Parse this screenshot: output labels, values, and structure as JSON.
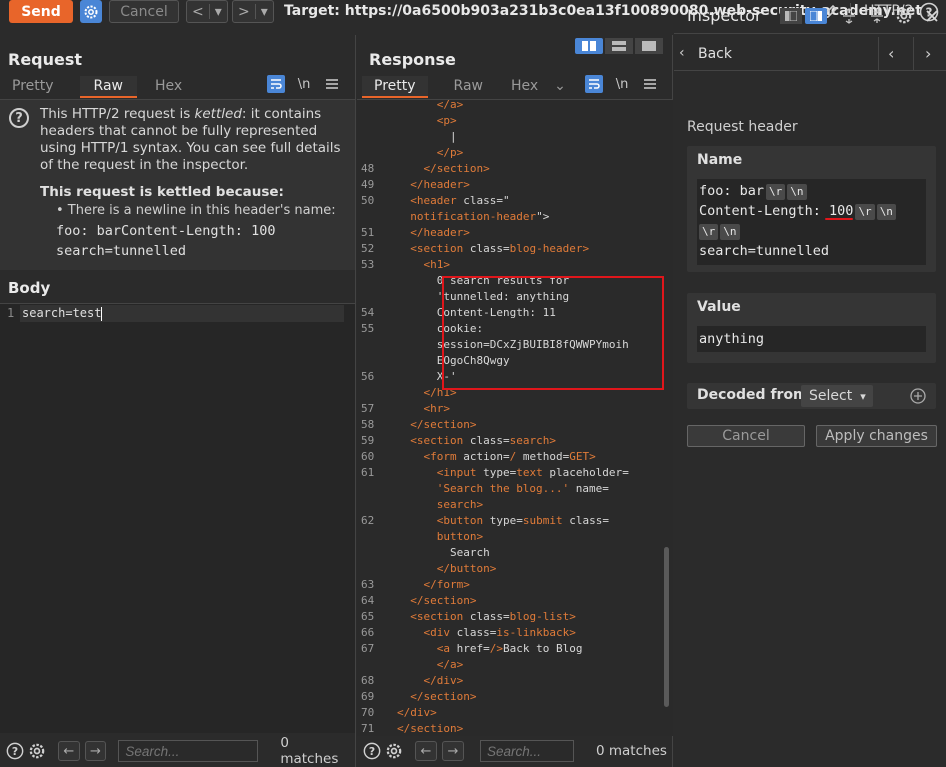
{
  "toolbar": {
    "send_label": "Send",
    "cancel_label": "Cancel",
    "target_label": "Target: https://0a6500b903a231b3c0ea13f100890080.web-security-academy.net",
    "protocol_label": "HTTP/2",
    "back_glyph": "<",
    "forward_glyph": ">",
    "dropdown_glyph": "▾"
  },
  "request": {
    "title": "Request",
    "tabs": [
      "Pretty",
      "Raw",
      "Hex"
    ],
    "active_tab": "Raw",
    "newline_label": "\\n",
    "kettled": {
      "intro_pre": "This HTTP/2 request is ",
      "intro_em": "kettled",
      "intro_post": ": it contains headers that cannot be fully represented using HTTP/1 syntax. You can see full details of the request in the inspector.",
      "reason_title": "This request is kettled because:",
      "reason_item": "• There is a newline in this header's name:",
      "code_line1": "foo: barContent-Length: 100",
      "code_line2": "search=tunnelled"
    },
    "body_title": "Body",
    "body_lines": [
      {
        "num": "1",
        "text": "search=test"
      }
    ],
    "search_placeholder": "Search...",
    "matches": "0 matches"
  },
  "response": {
    "title": "Response",
    "tabs": [
      "Pretty",
      "Raw",
      "Hex"
    ],
    "active_tab": "Pretty",
    "newline_label": "\\n",
    "search_placeholder": "Search...",
    "matches": "0 matches",
    "code_lines": [
      {
        "n": "",
        "indent": 6,
        "parts": [
          [
            "tag",
            "</a>"
          ]
        ]
      },
      {
        "n": "",
        "indent": 6,
        "parts": [
          [
            "tag",
            "<p>"
          ]
        ]
      },
      {
        "n": "",
        "indent": 8,
        "parts": [
          [
            "plain",
            "|"
          ]
        ]
      },
      {
        "n": "",
        "indent": 6,
        "parts": [
          [
            "tag",
            "</p>"
          ]
        ]
      },
      {
        "n": "48",
        "indent": 4,
        "parts": [
          [
            "tag",
            "</section>"
          ]
        ]
      },
      {
        "n": "49",
        "indent": 2,
        "parts": [
          [
            "tag",
            "</header>"
          ]
        ]
      },
      {
        "n": "50",
        "indent": 2,
        "parts": [
          [
            "tag",
            "<header "
          ],
          [
            "attr",
            "class"
          ],
          [
            "plain",
            "=\""
          ]
        ]
      },
      {
        "n": "",
        "indent": 2,
        "parts": [
          [
            "val",
            "notification-header"
          ],
          [
            "plain",
            "\">"
          ]
        ]
      },
      {
        "n": "51",
        "indent": 2,
        "parts": [
          [
            "tag",
            "</header>"
          ]
        ]
      },
      {
        "n": "52",
        "indent": 2,
        "parts": [
          [
            "tag",
            "<section "
          ],
          [
            "attr",
            "class"
          ],
          [
            "plain",
            "="
          ],
          [
            "val",
            "blog-header"
          ],
          [
            "tag",
            ">"
          ]
        ]
      },
      {
        "n": "53",
        "indent": 4,
        "parts": [
          [
            "tag",
            "<h1>"
          ]
        ]
      },
      {
        "n": "",
        "indent": 6,
        "parts": [
          [
            "plain",
            "0 search results for"
          ]
        ]
      },
      {
        "n": "",
        "indent": 6,
        "parts": [
          [
            "plain",
            "'tunnelled: anything"
          ]
        ]
      },
      {
        "n": "54",
        "indent": 6,
        "parts": [
          [
            "plain",
            "Content-Length: 11"
          ]
        ]
      },
      {
        "n": "55",
        "indent": 6,
        "parts": [
          [
            "plain",
            "cookie:"
          ]
        ]
      },
      {
        "n": "",
        "indent": 6,
        "parts": [
          [
            "plain",
            "session=DCxZjBUIBI8fQWWPYmoih"
          ]
        ]
      },
      {
        "n": "",
        "indent": 6,
        "parts": [
          [
            "plain",
            "EOgoCh8Qwgy"
          ]
        ]
      },
      {
        "n": "56",
        "indent": 6,
        "parts": [
          [
            "plain",
            "X-'"
          ]
        ]
      },
      {
        "n": "",
        "indent": 4,
        "parts": [
          [
            "tag",
            "</h1>"
          ]
        ]
      },
      {
        "n": "57",
        "indent": 4,
        "parts": [
          [
            "tag",
            "<hr>"
          ]
        ]
      },
      {
        "n": "58",
        "indent": 2,
        "parts": [
          [
            "tag",
            "</section>"
          ]
        ]
      },
      {
        "n": "59",
        "indent": 2,
        "parts": [
          [
            "tag",
            "<section "
          ],
          [
            "attr",
            "class"
          ],
          [
            "plain",
            "="
          ],
          [
            "val",
            "search"
          ],
          [
            "tag",
            ">"
          ]
        ]
      },
      {
        "n": "60",
        "indent": 4,
        "parts": [
          [
            "tag",
            "<form "
          ],
          [
            "attr",
            "action"
          ],
          [
            "plain",
            "="
          ],
          [
            "val",
            "/"
          ],
          [
            "plain",
            " "
          ],
          [
            "attr",
            "method"
          ],
          [
            "plain",
            "="
          ],
          [
            "val",
            "GET"
          ],
          [
            "tag",
            ">"
          ]
        ]
      },
      {
        "n": "61",
        "indent": 6,
        "parts": [
          [
            "tag",
            "<input "
          ],
          [
            "attr",
            "type"
          ],
          [
            "plain",
            "="
          ],
          [
            "val",
            "text"
          ],
          [
            "plain",
            " "
          ],
          [
            "attr",
            "placeholder"
          ],
          [
            "plain",
            "="
          ]
        ]
      },
      {
        "n": "",
        "indent": 6,
        "parts": [
          [
            "val",
            "'Search the blog...'"
          ],
          [
            "plain",
            " "
          ],
          [
            "attr",
            "name"
          ],
          [
            "plain",
            "="
          ]
        ]
      },
      {
        "n": "",
        "indent": 6,
        "parts": [
          [
            "val",
            "search"
          ],
          [
            "tag",
            ">"
          ]
        ]
      },
      {
        "n": "62",
        "indent": 6,
        "parts": [
          [
            "tag",
            "<button "
          ],
          [
            "attr",
            "type"
          ],
          [
            "plain",
            "="
          ],
          [
            "val",
            "submit"
          ],
          [
            "plain",
            " "
          ],
          [
            "attr",
            "class"
          ],
          [
            "plain",
            "="
          ]
        ]
      },
      {
        "n": "",
        "indent": 6,
        "parts": [
          [
            "val",
            "button"
          ],
          [
            "tag",
            ">"
          ]
        ]
      },
      {
        "n": "",
        "indent": 8,
        "parts": [
          [
            "plain",
            "Search"
          ]
        ]
      },
      {
        "n": "",
        "indent": 6,
        "parts": [
          [
            "tag",
            "</button>"
          ]
        ]
      },
      {
        "n": "63",
        "indent": 4,
        "parts": [
          [
            "tag",
            "</form>"
          ]
        ]
      },
      {
        "n": "64",
        "indent": 2,
        "parts": [
          [
            "tag",
            "</section>"
          ]
        ]
      },
      {
        "n": "65",
        "indent": 2,
        "parts": [
          [
            "tag",
            "<section "
          ],
          [
            "attr",
            "class"
          ],
          [
            "plain",
            "="
          ],
          [
            "val",
            "blog-list"
          ],
          [
            "tag",
            ">"
          ]
        ]
      },
      {
        "n": "66",
        "indent": 4,
        "parts": [
          [
            "tag",
            "<div "
          ],
          [
            "attr",
            "class"
          ],
          [
            "plain",
            "="
          ],
          [
            "val",
            "is-linkback"
          ],
          [
            "tag",
            ">"
          ]
        ]
      },
      {
        "n": "67",
        "indent": 6,
        "parts": [
          [
            "tag",
            "<a "
          ],
          [
            "attr",
            "href"
          ],
          [
            "plain",
            "="
          ],
          [
            "val",
            "/"
          ],
          [
            "tag",
            ">"
          ],
          [
            "plain",
            "Back to Blog"
          ]
        ]
      },
      {
        "n": "",
        "indent": 6,
        "parts": [
          [
            "tag",
            "</a>"
          ]
        ]
      },
      {
        "n": "68",
        "indent": 4,
        "parts": [
          [
            "tag",
            "</div>"
          ]
        ]
      },
      {
        "n": "69",
        "indent": 2,
        "parts": [
          [
            "tag",
            "</section>"
          ]
        ]
      },
      {
        "n": "70",
        "indent": 0,
        "parts": [
          [
            "tag",
            "</div>"
          ]
        ]
      },
      {
        "n": "71",
        "indent": 0,
        "parts": [
          [
            "tag",
            "</section>"
          ]
        ]
      }
    ]
  },
  "inspector": {
    "title": "Inspector",
    "back_label": "Back",
    "section_label": "Request header",
    "name_label": "Name",
    "name_line1": "foo: bar",
    "name_line2": "Content-Length: ",
    "name_line2_value": "100",
    "name_line4": "search=tunnelled",
    "escape_r": "\\r",
    "escape_n": "\\n",
    "value_label": "Value",
    "value_text": "anything",
    "decoded_label": "Decoded from:",
    "decoded_select": "Select",
    "cancel_label": "Cancel",
    "apply_label": "Apply changes"
  },
  "colors": {
    "accent": "#e8652a",
    "highlight_box": "#e0161b",
    "blue_toggle": "#4a86d6"
  }
}
